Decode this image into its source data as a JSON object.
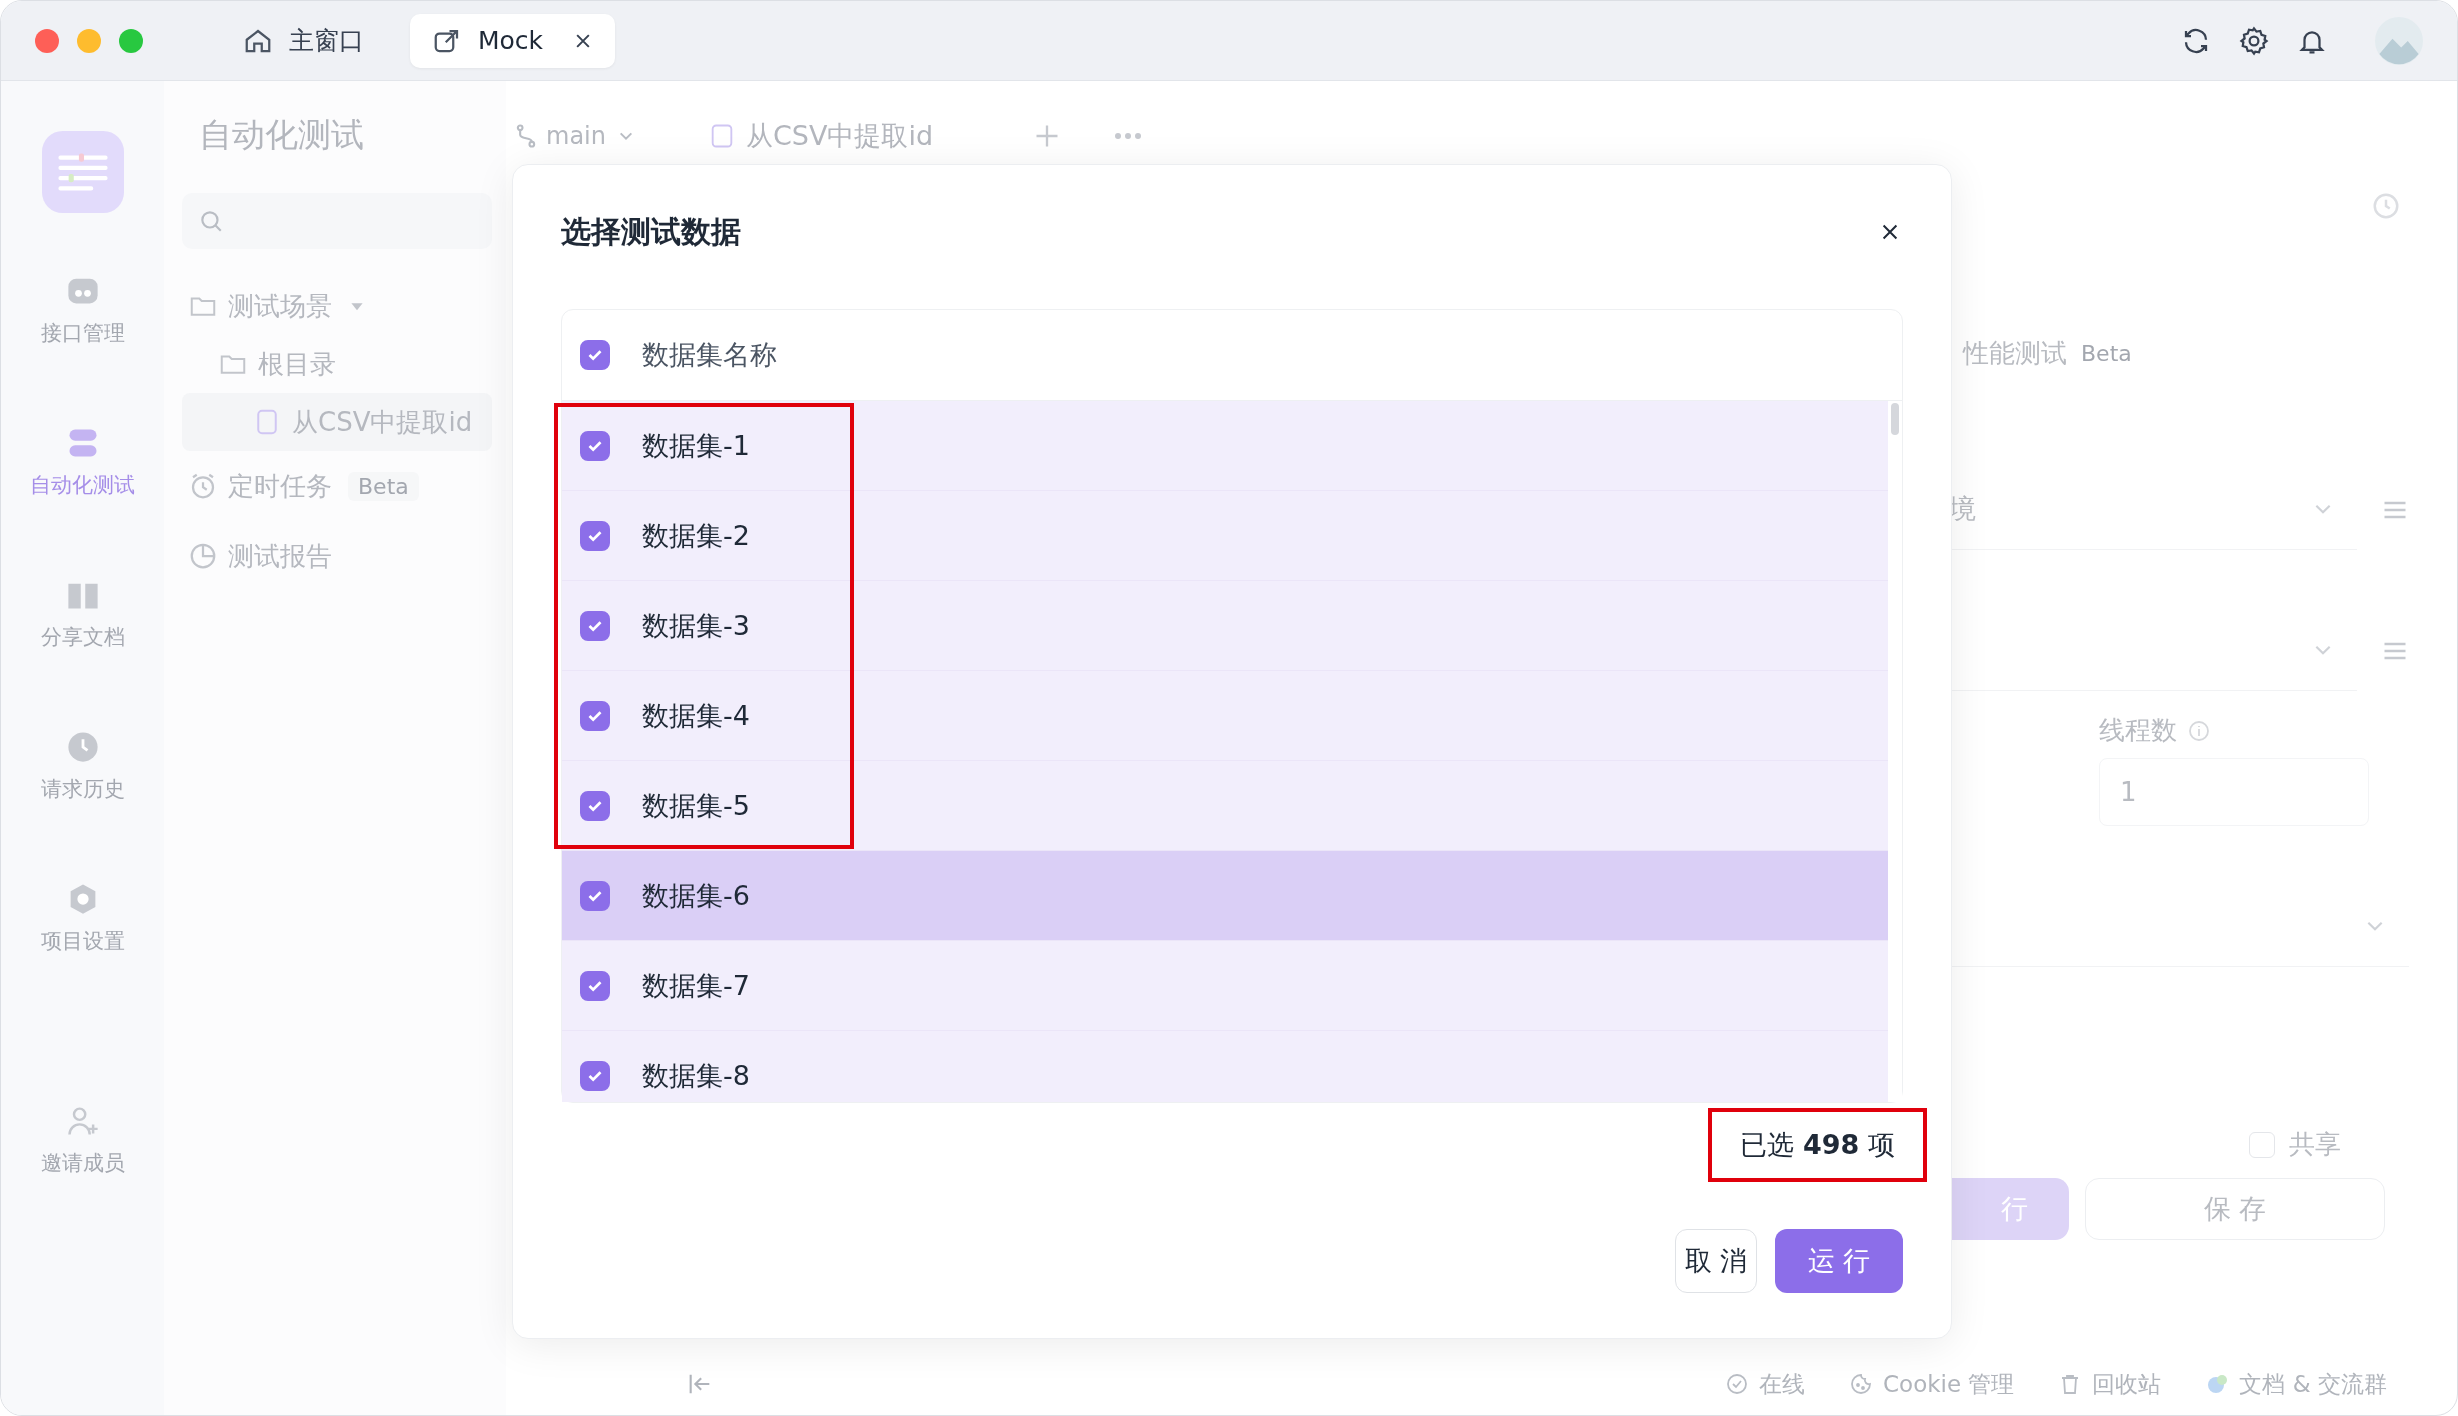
{
  "title_bar": {
    "tabs": [
      {
        "label": "主窗口",
        "selected": false,
        "closable": false
      },
      {
        "label": "Mock",
        "selected": true,
        "closable": true
      }
    ]
  },
  "rail": {
    "items": [
      {
        "label": "接口管理",
        "selected": false
      },
      {
        "label": "自动化测试",
        "selected": true
      },
      {
        "label": "分享文档",
        "selected": false
      },
      {
        "label": "请求历史",
        "selected": false
      },
      {
        "label": "项目设置",
        "selected": false
      }
    ],
    "invite": {
      "label": "邀请成员"
    }
  },
  "sidebar": {
    "title": "自动化测试",
    "tree": [
      {
        "label": "测试场景",
        "expanded": true,
        "children": [
          {
            "label": "根目录",
            "selected": false,
            "children": [
              {
                "label": "从CSV中提取id",
                "selected": true
              }
            ]
          }
        ]
      }
    ],
    "nav": [
      {
        "label": "定时任务",
        "badge": "Beta"
      },
      {
        "label": "测试报告"
      }
    ]
  },
  "editor_header": {
    "branch": "main",
    "tab": "从CSV中提取id"
  },
  "right_panel": {
    "section": {
      "label": "性能测试",
      "badge": "Beta"
    },
    "environment_select": {
      "value": "境"
    },
    "threads": {
      "label": "线程数",
      "value": "1"
    },
    "share": {
      "label": "共享",
      "checked": false
    },
    "buttons": [
      {
        "label": "行",
        "kind": "primary"
      },
      {
        "label": "保 存",
        "kind": "secondary"
      }
    ]
  },
  "status_bar": {
    "items": [
      "在线",
      "Cookie 管理",
      "回收站",
      "文档 & 交流群"
    ]
  },
  "dialog": {
    "title": "选择测试数据",
    "header": {
      "label": "数据集名称",
      "checked": true
    },
    "row_groups": [
      {
        "boxed": true,
        "rows": [
          {
            "label": "数据集-1",
            "checked": true,
            "hovered": false
          },
          {
            "label": "数据集-2",
            "checked": true,
            "hovered": false
          },
          {
            "label": "数据集-3",
            "checked": true,
            "hovered": false
          },
          {
            "label": "数据集-4",
            "checked": true,
            "hovered": false
          },
          {
            "label": "数据集-5",
            "checked": true,
            "hovered": false
          }
        ]
      },
      {
        "boxed": false,
        "rows": [
          {
            "label": "数据集-6",
            "checked": true,
            "hovered": true
          },
          {
            "label": "数据集-7",
            "checked": true,
            "hovered": false
          },
          {
            "label": "数据集-8",
            "checked": true,
            "hovered": false
          }
        ]
      }
    ],
    "summary": {
      "text": "已选 **498** 项",
      "boxed": true
    },
    "buttons": [
      {
        "label": "取 消",
        "kind": "secondary"
      },
      {
        "label": "运 行",
        "kind": "primary"
      }
    ]
  }
}
